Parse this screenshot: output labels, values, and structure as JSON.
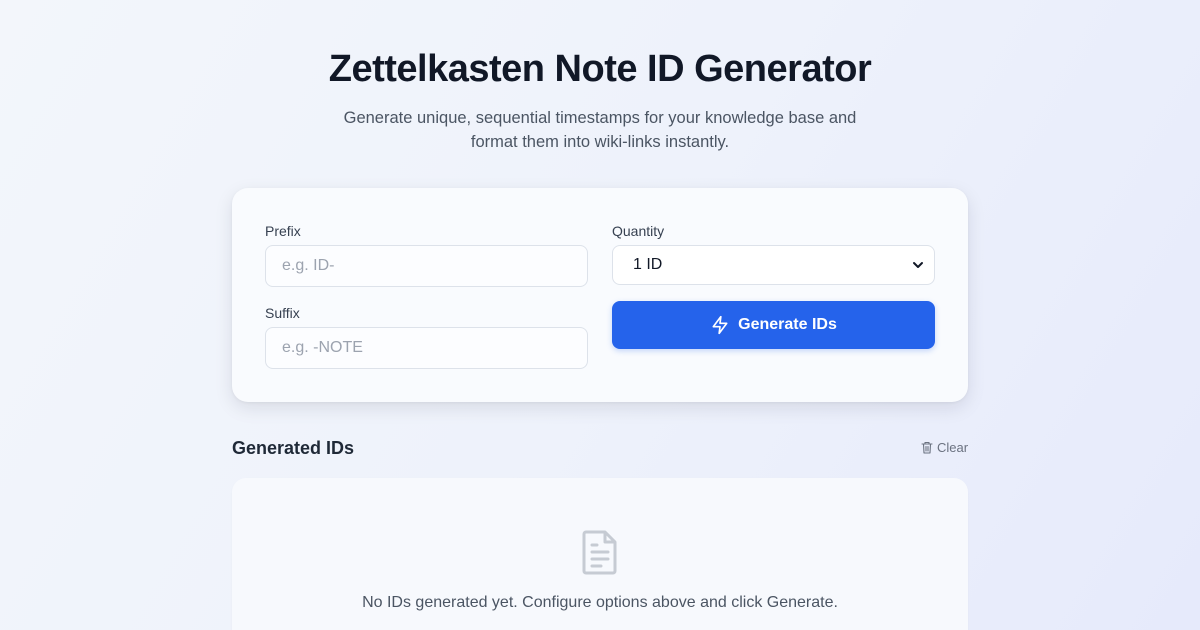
{
  "header": {
    "title": "Zettelkasten Note ID Generator",
    "subtitle": "Generate unique, sequential timestamps for your knowledge base and format them into wiki-links instantly."
  },
  "form": {
    "prefix": {
      "label": "Prefix",
      "placeholder": "e.g. ID-",
      "value": ""
    },
    "suffix": {
      "label": "Suffix",
      "placeholder": "e.g. -NOTE",
      "value": ""
    },
    "quantity": {
      "label": "Quantity",
      "selected": "1 ID"
    },
    "generate_label": "Generate IDs",
    "generate_icon": "lightning-icon"
  },
  "results": {
    "title": "Generated IDs",
    "clear_label": "Clear",
    "clear_icon": "trash-icon",
    "empty_icon": "document-icon",
    "empty_message": "No IDs generated yet. Configure options above and click Generate."
  },
  "colors": {
    "accent": "#2563eb",
    "background": "#eef2fb"
  }
}
